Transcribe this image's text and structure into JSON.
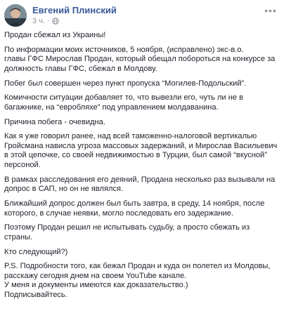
{
  "post": {
    "author": "Евгений Плинский",
    "time": "3 ч.",
    "separator": "·",
    "privacy_icon": "globe-icon",
    "more_icon": "more-options-icon",
    "more_label": "•••",
    "paragraphs": [
      [
        "Продан сбежал из Украины!"
      ],
      [
        "По информации моих источников, 5 ноября,  (исправлено)  экс-в.о.",
        "главы ГФС Мирослав Продан, который обещал побороться на конкурсе за",
        "должность главы ГФС, сбежал в Молдову."
      ],
      [
        "Побег был совершен через пункт пропуска “Могилев-Подольский”."
      ],
      [
        "Комичности ситуации добавляет то, что вывезли его, чуть ли не в",
        "багажнике, на “евробляхе” под управлением молдаванина."
      ],
      [
        "Причина побега - очевидна."
      ],
      [
        "Как я уже говорил ранее, над всей таможенно-налоговой вертикалью",
        "Гройсмана нависла угроза массовых задержаний, и Мирослав Васильевич",
        "в этой цепочке, со своей недвижимостью в Турции, был самой “вкусной”",
        "персоной."
      ],
      [
        "В рамках расследования его деяний, Продана несколько раз вызывали на",
        "допрос в САП, но он не являлся."
      ],
      [
        "Ближайший допрос должен был быть завтра, в среду, 14 ноября, после",
        "которого, в случае неявки, могло последовать его задержание."
      ],
      [
        "Поэтому Продан решил не испытывать судьбу, а просто сбежать из",
        "страны."
      ],
      [
        "Кто следующий?)"
      ],
      [
        "P.S. Подробности того, как бежал Продан и куда он полетел из Молдовы,",
        "расскажу сегодня днем на своем YouTube канале.",
        "У меня и документы имеются как доказательство.)",
        "Подписывайтесь."
      ]
    ]
  }
}
